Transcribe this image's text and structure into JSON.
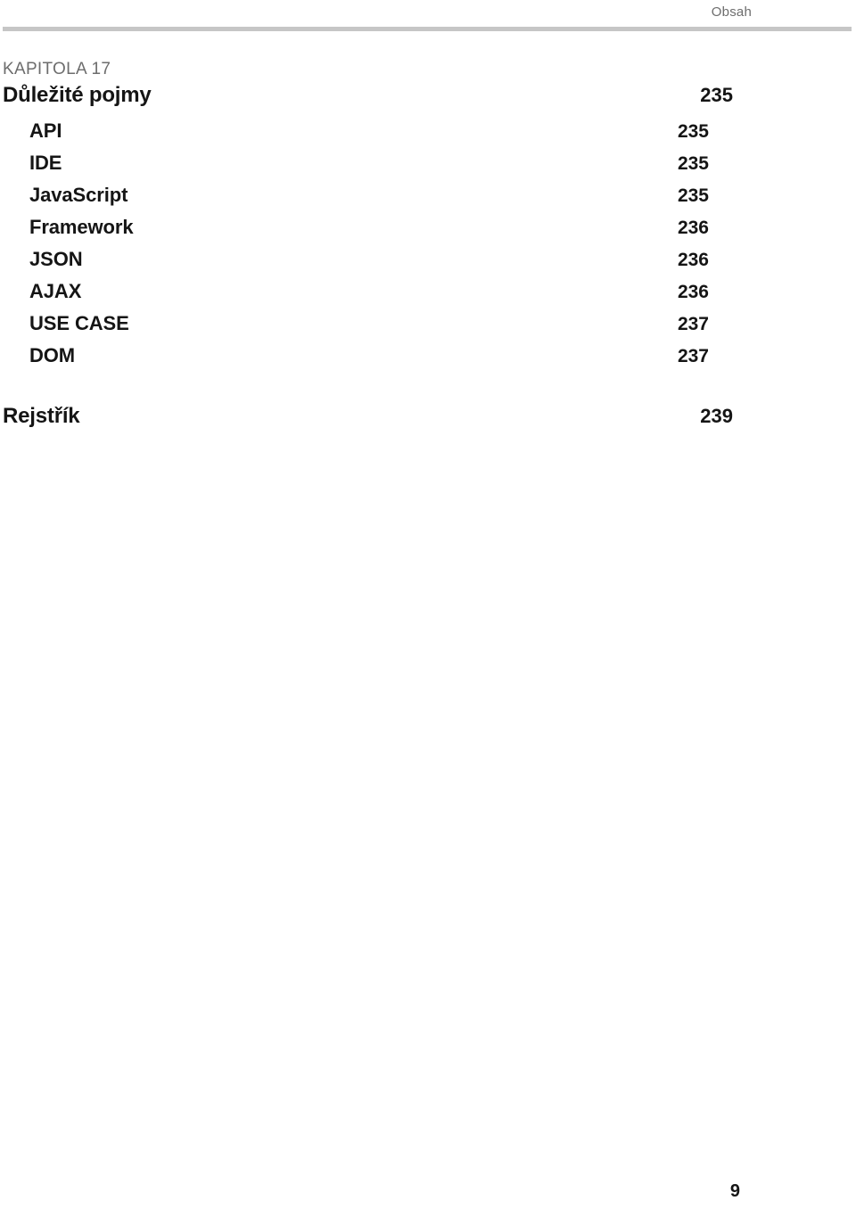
{
  "header": {
    "running_head": "Obsah"
  },
  "chapter": {
    "label": "KAPITOLA 17",
    "title": "Důležité pojmy",
    "page": "235"
  },
  "entries": [
    {
      "label": "API",
      "page": "235"
    },
    {
      "label": "IDE",
      "page": "235"
    },
    {
      "label": "JavaScript",
      "page": "235"
    },
    {
      "label": "Framework",
      "page": "236"
    },
    {
      "label": "JSON",
      "page": "236"
    },
    {
      "label": "AJAX",
      "page": "236"
    },
    {
      "label": "USE CASE",
      "page": "237"
    },
    {
      "label": "DOM",
      "page": "237"
    }
  ],
  "index": {
    "title": "Rejstřík",
    "page": "239"
  },
  "footer": {
    "folio": "9"
  },
  "colors": {
    "text": "#151515",
    "muted": "#6d6d6d",
    "rule": "#c6c6c6",
    "background": "#ffffff"
  }
}
